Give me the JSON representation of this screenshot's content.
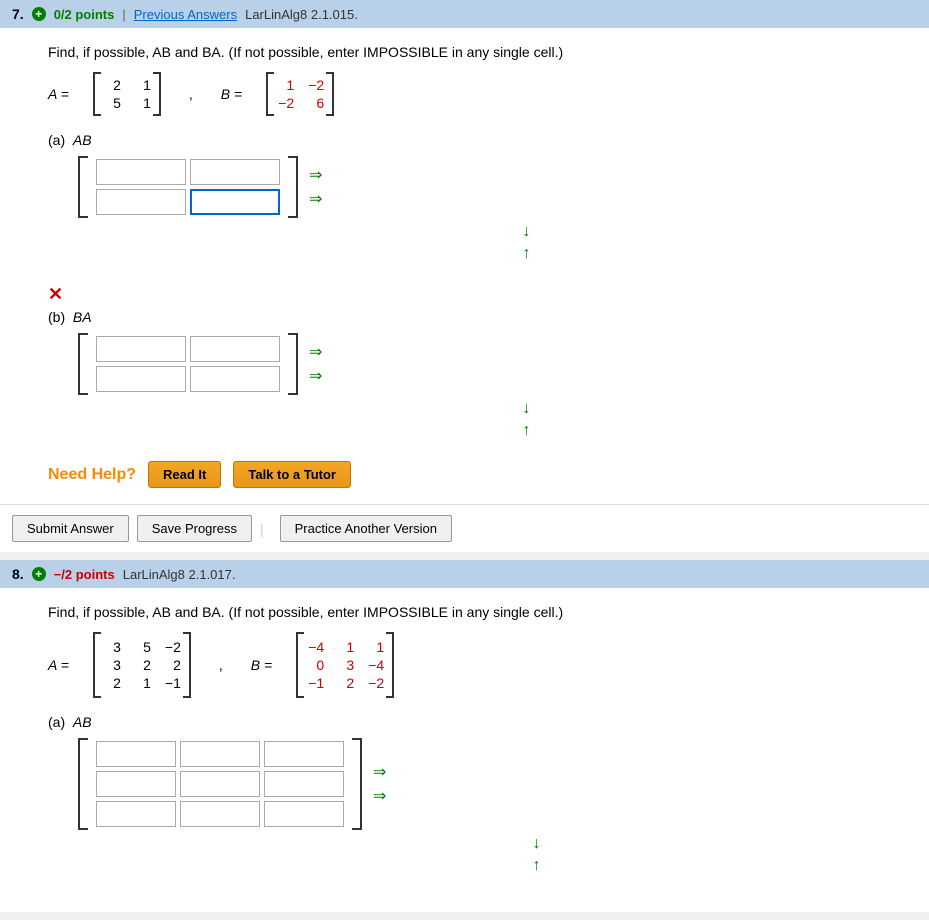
{
  "questions": [
    {
      "number": "7.",
      "points": "0/2 points",
      "points_class": "points-badge",
      "prev_answers": "Previous Answers",
      "course_code": "LarLinAlg8 2.1.015.",
      "problem": "Find, if possible, AB and BA. (If not possible, enter IMPOSSIBLE in any single cell.)",
      "matrix_a_label": "A =",
      "matrix_a": [
        [
          "2",
          "1"
        ],
        [
          "5",
          "1"
        ]
      ],
      "matrix_b_label": "B =",
      "matrix_b": [
        [
          "1",
          "−2"
        ],
        [
          "−2",
          "6"
        ]
      ],
      "matrix_b_red": true,
      "parts": [
        {
          "label": "(a)",
          "var": "AB",
          "rows": 2,
          "cols": 2,
          "has_x": false,
          "active_cell": [
            1,
            1
          ]
        },
        {
          "label": "(b)",
          "var": "BA",
          "rows": 2,
          "cols": 2,
          "has_x": true,
          "active_cell": null
        }
      ],
      "need_help_label": "Need Help?",
      "read_it": "Read It",
      "talk_tutor": "Talk to a Tutor",
      "submit": "Submit Answer",
      "save": "Save Progress",
      "practice": "Practice Another Version"
    },
    {
      "number": "8.",
      "points": "−/2 points",
      "points_class": "points-neg",
      "prev_answers": null,
      "course_code": "LarLinAlg8 2.1.017.",
      "problem": "Find, if possible, AB and BA. (If not possible, enter IMPOSSIBLE in any single cell.)",
      "matrix_a_label": "A =",
      "matrix_a": [
        [
          "3",
          "5",
          "−2"
        ],
        [
          "3",
          "2",
          "2"
        ],
        [
          "2",
          "1",
          "−1"
        ]
      ],
      "matrix_b_label": "B =",
      "matrix_b": [
        [
          "−4",
          "1",
          "1"
        ],
        [
          "0",
          "3",
          "−4"
        ],
        [
          "−1",
          "2",
          "−2"
        ]
      ],
      "matrix_b_red": true,
      "parts": [
        {
          "label": "(a)",
          "var": "AB",
          "rows": 3,
          "cols": 3,
          "has_x": false,
          "active_cell": null
        }
      ],
      "need_help_label": null,
      "read_it": null,
      "talk_tutor": null,
      "submit": null,
      "save": null,
      "practice": null
    }
  ]
}
